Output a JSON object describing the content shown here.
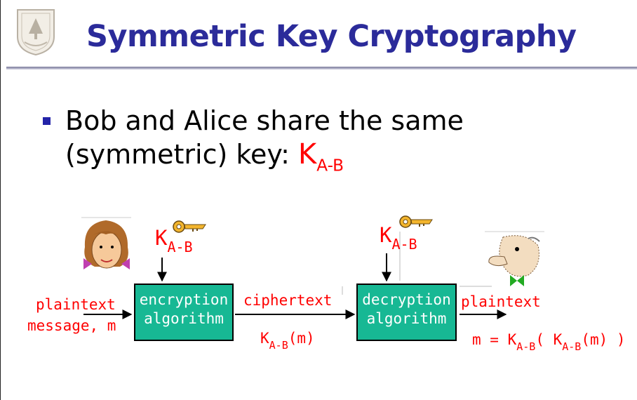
{
  "title": "Symmetric Key Cryptography",
  "bullet": {
    "text": "Bob and Alice share the same (symmetric) key: ",
    "key_symbol": "K",
    "key_sub": "A-B"
  },
  "diagram": {
    "input_label_line1": "plaintext",
    "input_label_line2": "message, m",
    "encryption_box_line1": "encryption",
    "encryption_box_line2": "algorithm",
    "decryption_box_line1": "decryption",
    "decryption_box_line2": "algorithm",
    "channel_label": "ciphertext",
    "output_label": "plaintext",
    "key_label_symbol": "K",
    "key_label_sub": "A-B",
    "cipher_expr_symbol": "K",
    "cipher_expr_sub": "A-B",
    "cipher_expr_arg": "(m)",
    "result_prefix": "m = K",
    "result_sub1": "A-B",
    "result_mid": "( K",
    "result_sub2": "A-B",
    "result_tail": "(m) )"
  },
  "colors": {
    "title": "#2b2b9a",
    "accent": "#ff0000",
    "box": "#17b894"
  },
  "icons": [
    "university-seal-icon",
    "alice-face-icon",
    "bob-face-icon",
    "key-icon"
  ]
}
